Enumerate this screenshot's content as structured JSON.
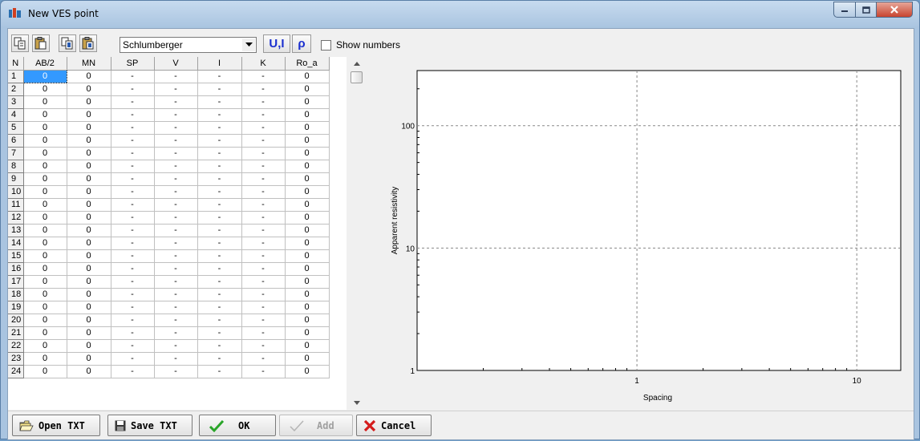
{
  "window": {
    "title": "New VES point"
  },
  "toolbar": {
    "copy_icon": "copy-icon",
    "paste_icon": "paste-icon",
    "array_type": "Schlumberger",
    "ui_button": "U,I",
    "rho_button": "ρ",
    "show_numbers_label": "Show numbers",
    "show_numbers_checked": false
  },
  "grid": {
    "columns": [
      "N",
      "AB/2",
      "MN",
      "SP",
      "V",
      "I",
      "K",
      "Ro_a"
    ],
    "rows": [
      [
        "1",
        "0",
        "0",
        "-",
        "-",
        "-",
        "-",
        "0"
      ],
      [
        "2",
        "0",
        "0",
        "-",
        "-",
        "-",
        "-",
        "0"
      ],
      [
        "3",
        "0",
        "0",
        "-",
        "-",
        "-",
        "-",
        "0"
      ],
      [
        "4",
        "0",
        "0",
        "-",
        "-",
        "-",
        "-",
        "0"
      ],
      [
        "5",
        "0",
        "0",
        "-",
        "-",
        "-",
        "-",
        "0"
      ],
      [
        "6",
        "0",
        "0",
        "-",
        "-",
        "-",
        "-",
        "0"
      ],
      [
        "7",
        "0",
        "0",
        "-",
        "-",
        "-",
        "-",
        "0"
      ],
      [
        "8",
        "0",
        "0",
        "-",
        "-",
        "-",
        "-",
        "0"
      ],
      [
        "9",
        "0",
        "0",
        "-",
        "-",
        "-",
        "-",
        "0"
      ],
      [
        "10",
        "0",
        "0",
        "-",
        "-",
        "-",
        "-",
        "0"
      ],
      [
        "11",
        "0",
        "0",
        "-",
        "-",
        "-",
        "-",
        "0"
      ],
      [
        "12",
        "0",
        "0",
        "-",
        "-",
        "-",
        "-",
        "0"
      ],
      [
        "13",
        "0",
        "0",
        "-",
        "-",
        "-",
        "-",
        "0"
      ],
      [
        "14",
        "0",
        "0",
        "-",
        "-",
        "-",
        "-",
        "0"
      ],
      [
        "15",
        "0",
        "0",
        "-",
        "-",
        "-",
        "-",
        "0"
      ],
      [
        "16",
        "0",
        "0",
        "-",
        "-",
        "-",
        "-",
        "0"
      ],
      [
        "17",
        "0",
        "0",
        "-",
        "-",
        "-",
        "-",
        "0"
      ],
      [
        "18",
        "0",
        "0",
        "-",
        "-",
        "-",
        "-",
        "0"
      ],
      [
        "19",
        "0",
        "0",
        "-",
        "-",
        "-",
        "-",
        "0"
      ],
      [
        "20",
        "0",
        "0",
        "-",
        "-",
        "-",
        "-",
        "0"
      ],
      [
        "21",
        "0",
        "0",
        "-",
        "-",
        "-",
        "-",
        "0"
      ],
      [
        "22",
        "0",
        "0",
        "-",
        "-",
        "-",
        "-",
        "0"
      ],
      [
        "23",
        "0",
        "0",
        "-",
        "-",
        "-",
        "-",
        "0"
      ],
      [
        "24",
        "0",
        "0",
        "-",
        "-",
        "-",
        "-",
        "0"
      ]
    ]
  },
  "chart_data": {
    "type": "scatter",
    "title": "",
    "xlabel": "Spacing",
    "ylabel": "Apparent resistivity",
    "x_scale": "log",
    "y_scale": "log",
    "x_ticks": [
      "1",
      "10"
    ],
    "y_ticks": [
      "1",
      "10",
      "100"
    ],
    "grid": true,
    "series": []
  },
  "buttons": {
    "open": "Open TXT",
    "save": "Save TXT",
    "ok": "OK",
    "add": "Add",
    "cancel": "Cancel"
  }
}
